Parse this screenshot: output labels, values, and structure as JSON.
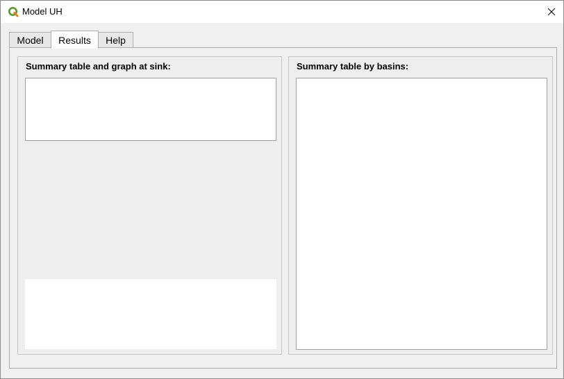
{
  "window": {
    "title": "Model UH",
    "app_icon": "qgis-logo-icon",
    "close_icon": "close-icon"
  },
  "tabs": [
    {
      "label": "Model",
      "active": false
    },
    {
      "label": "Results",
      "active": true
    },
    {
      "label": "Help",
      "active": false
    }
  ],
  "results": {
    "sink_group_title": "Summary table and graph at sink:",
    "basins_group_title": "Summary table by basins:"
  },
  "colors": {
    "qgis_green": "#589632",
    "qgis_yellow": "#ee7913"
  }
}
